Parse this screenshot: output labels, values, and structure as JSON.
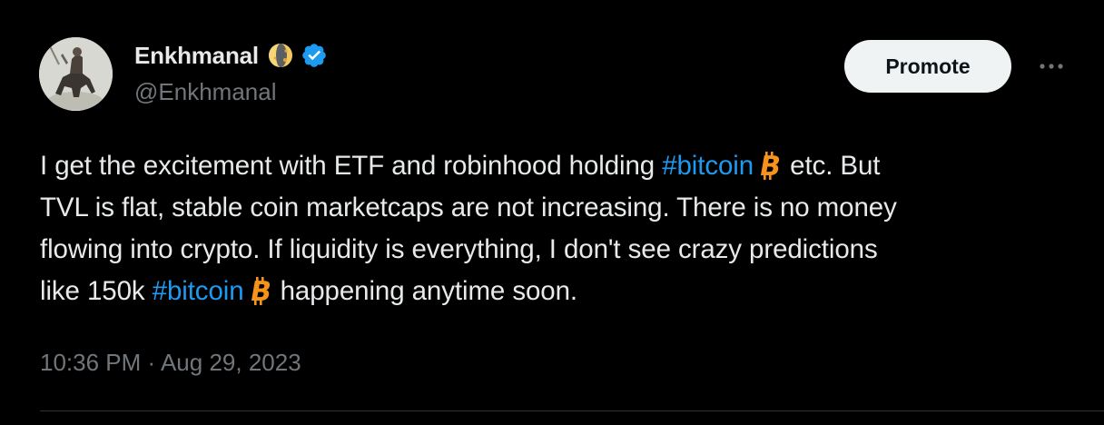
{
  "author": {
    "display_name": "Enkhmanal",
    "handle": "@Enkhmanal",
    "badge_icon": "moon-emoji-icon",
    "verified_icon": "verified-badge-icon",
    "avatar": "avatar-image"
  },
  "actions": {
    "promote_label": "Promote",
    "more_icon": "more-options-icon"
  },
  "tweet": {
    "line1_before": "I get the excitement with ETF and robinhood holding ",
    "hashtag1": "#bitcoin",
    "line1_after": " etc. But",
    "line2": "TVL is flat, stable coin marketcaps are not increasing. There is no money",
    "line3": "flowing into crypto. If liquidity is everything,  I don't see crazy predictions",
    "line4_before": "like 150k ",
    "hashtag2": "#bitcoin",
    "line4_after": " happening anytime soon."
  },
  "meta": {
    "time": "10:36 PM",
    "separator": " · ",
    "date": "Aug 29, 2023"
  },
  "colors": {
    "background": "#000000",
    "text": "#e7e9ea",
    "secondary": "#71767b",
    "link": "#1d9bf0",
    "verified": "#1d9bf0",
    "bitcoin": "#f7931a",
    "promote_bg": "#eff3f4"
  }
}
